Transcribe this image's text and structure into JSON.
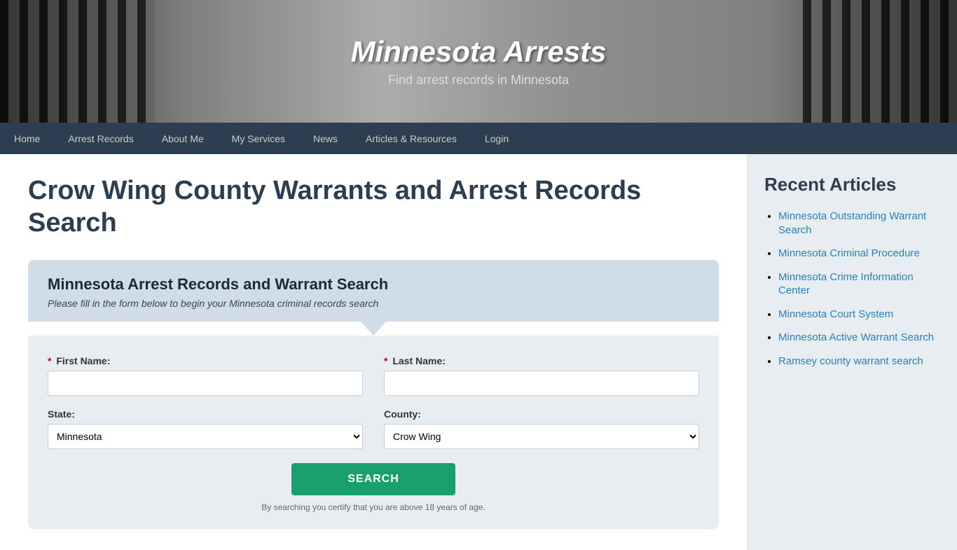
{
  "header": {
    "title": "Minnesota Arrests",
    "subtitle": "Find arrest records in Minnesota",
    "bg_alt": "Prison bars background"
  },
  "nav": {
    "items": [
      {
        "label": "Home",
        "active": false
      },
      {
        "label": "Arrest Records",
        "active": false
      },
      {
        "label": "About Me",
        "active": false
      },
      {
        "label": "My Services",
        "active": false
      },
      {
        "label": "News",
        "active": false
      },
      {
        "label": "Articles & Resources",
        "active": false
      },
      {
        "label": "Login",
        "active": false
      }
    ]
  },
  "main": {
    "page_title": "Crow Wing County Warrants and Arrest Records Search",
    "search_box": {
      "heading": "Minnesota Arrest Records and Warrant Search",
      "subheading": "Please fill in the form below to begin your Minnesota criminal records search",
      "first_name_label": "First Name:",
      "last_name_label": "Last Name:",
      "state_label": "State:",
      "county_label": "County:",
      "state_default": "Minnesota",
      "county_default": "Crow Wing",
      "search_btn_label": "SEARCH",
      "form_note": "By searching you certify that you are above 18 years of age."
    }
  },
  "sidebar": {
    "heading": "Recent Articles",
    "articles": [
      {
        "label": "Minnesota Outstanding Warrant Search"
      },
      {
        "label": "Minnesota Criminal Procedure"
      },
      {
        "label": "Minnesota Crime Information Center"
      },
      {
        "label": "Minnesota Court System"
      },
      {
        "label": "Minnesota Active Warrant Search"
      },
      {
        "label": "Ramsey county warrant search"
      }
    ]
  }
}
